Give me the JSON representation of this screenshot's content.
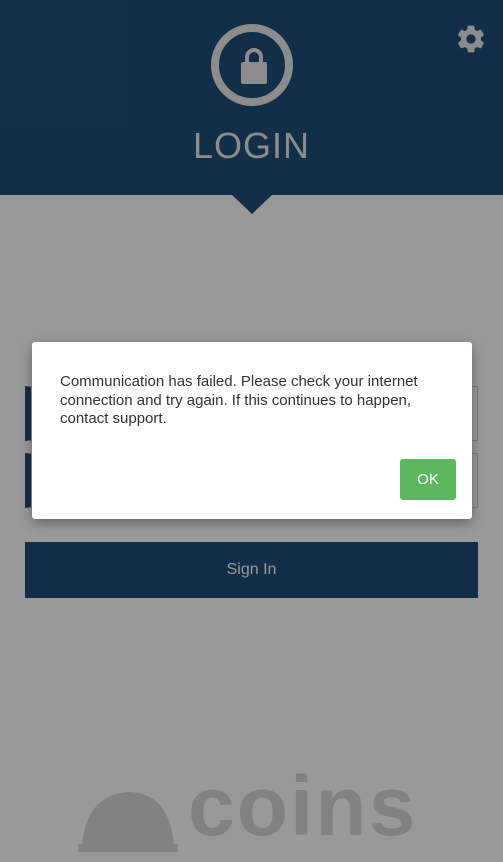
{
  "header": {
    "title": "LOGIN",
    "lock_icon": "lock-icon",
    "settings_icon": "gear-icon"
  },
  "form": {
    "username": {
      "value": "",
      "placeholder": ""
    },
    "password": {
      "value": "",
      "placeholder": ""
    },
    "signin_label": "Sign In"
  },
  "brand": {
    "name": "coins"
  },
  "dialog": {
    "message": "Communication has failed. Please check your internet connection and try again. If this continues to happen, contact support.",
    "ok_label": "OK"
  },
  "colors": {
    "primary": "#1f4e79",
    "ok_green": "#5cb85c",
    "overlay": "rgba(0,0,0,0.40)"
  }
}
